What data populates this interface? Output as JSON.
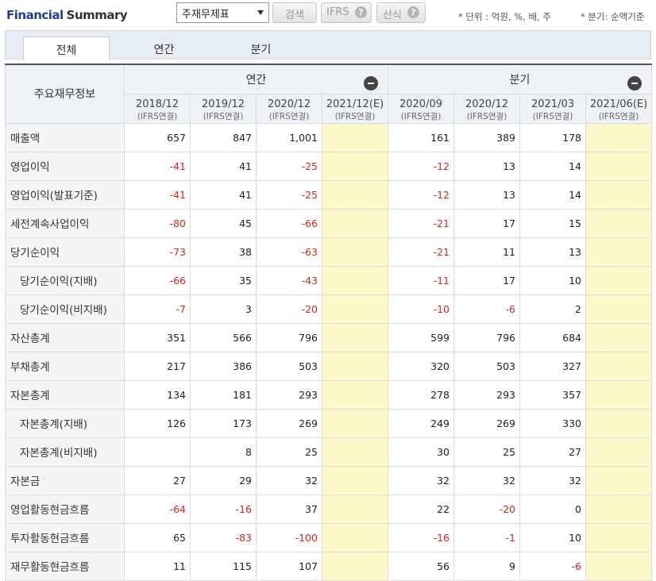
{
  "header": {
    "title_a": "Financial",
    "title_b": "Summary",
    "statement_select": "주재무제표",
    "search_label": "검색",
    "ifrs_label": "IFRS",
    "calc_label": "산식",
    "help_glyph": "?",
    "unit_note": "* 단위 : 억원, %, 배, 주",
    "quarter_note": "* 분기: 순액기준"
  },
  "tabs": [
    "전체",
    "연간",
    "분기"
  ],
  "table": {
    "corner_label": "주요재무정보",
    "group_annual": "연간",
    "group_quarter": "분기",
    "accounting": "(IFRS연결)",
    "periods": [
      "2018/12",
      "2019/12",
      "2020/12",
      "2021/12(E)",
      "2020/09",
      "2020/12",
      "2021/03",
      "2021/06(E)"
    ],
    "rows": [
      {
        "label": "매출액",
        "sub": false,
        "values": [
          "657",
          "847",
          "1,001",
          "",
          "161",
          "389",
          "178",
          ""
        ]
      },
      {
        "label": "영업이익",
        "sub": false,
        "values": [
          "-41",
          "41",
          "-25",
          "",
          "-12",
          "13",
          "14",
          ""
        ]
      },
      {
        "label": "영업이익(발표기준)",
        "sub": false,
        "values": [
          "-41",
          "41",
          "-25",
          "",
          "-12",
          "13",
          "14",
          ""
        ]
      },
      {
        "label": "세전계속사업이익",
        "sub": false,
        "values": [
          "-80",
          "45",
          "-66",
          "",
          "-21",
          "17",
          "15",
          ""
        ]
      },
      {
        "label": "당기순이익",
        "sub": false,
        "values": [
          "-73",
          "38",
          "-63",
          "",
          "-21",
          "11",
          "13",
          ""
        ]
      },
      {
        "label": "당기순이익(지배)",
        "sub": true,
        "values": [
          "-66",
          "35",
          "-43",
          "",
          "-11",
          "17",
          "10",
          ""
        ]
      },
      {
        "label": "당기순이익(비지배)",
        "sub": true,
        "values": [
          "-7",
          "3",
          "-20",
          "",
          "-10",
          "-6",
          "2",
          ""
        ]
      },
      {
        "label": "자산총계",
        "sub": false,
        "values": [
          "351",
          "566",
          "796",
          "",
          "599",
          "796",
          "684",
          ""
        ]
      },
      {
        "label": "부채총계",
        "sub": false,
        "values": [
          "217",
          "386",
          "503",
          "",
          "320",
          "503",
          "327",
          ""
        ]
      },
      {
        "label": "자본총계",
        "sub": false,
        "values": [
          "134",
          "181",
          "293",
          "",
          "278",
          "293",
          "357",
          ""
        ]
      },
      {
        "label": "자본총계(지배)",
        "sub": true,
        "values": [
          "126",
          "173",
          "269",
          "",
          "249",
          "269",
          "330",
          ""
        ]
      },
      {
        "label": "자본총계(비지배)",
        "sub": true,
        "values": [
          "",
          "8",
          "25",
          "",
          "30",
          "25",
          "27",
          ""
        ]
      },
      {
        "label": "자본금",
        "sub": false,
        "values": [
          "27",
          "29",
          "32",
          "",
          "32",
          "32",
          "32",
          ""
        ]
      },
      {
        "label": "영업활동현금흐름",
        "sub": false,
        "values": [
          "-64",
          "-16",
          "37",
          "",
          "22",
          "-20",
          "0",
          ""
        ]
      },
      {
        "label": "투자활동현금흐름",
        "sub": false,
        "values": [
          "65",
          "-83",
          "-100",
          "",
          "-16",
          "-1",
          "10",
          ""
        ]
      },
      {
        "label": "재무활동현금흐름",
        "sub": false,
        "values": [
          "11",
          "115",
          "107",
          "",
          "56",
          "9",
          "-6",
          ""
        ]
      }
    ]
  },
  "colors": {
    "title_blue": "#1f3f96",
    "negative": "#d0281e",
    "estimate_fill": "#fdf8c9",
    "header_fill": "#eef1f5"
  }
}
